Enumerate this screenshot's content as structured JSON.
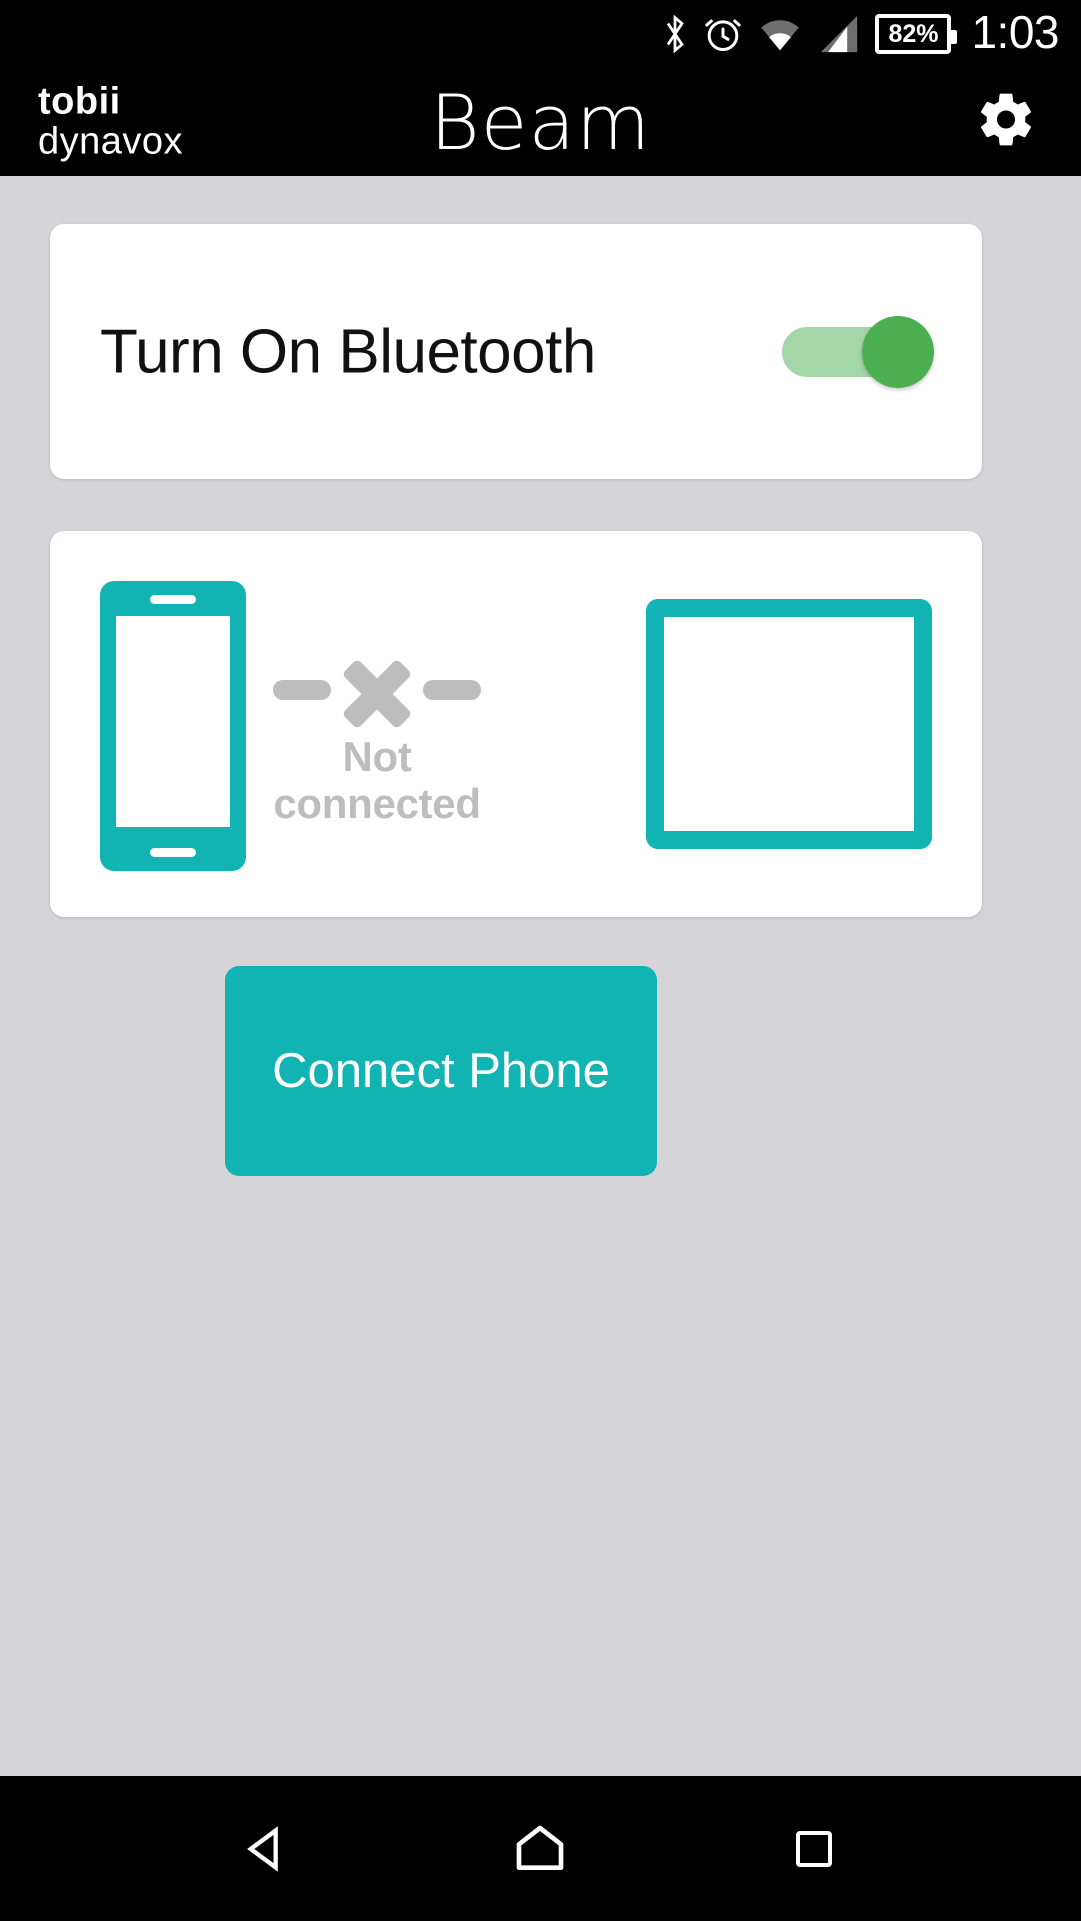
{
  "status_bar": {
    "icons": [
      "bluetooth-icon",
      "alarm-icon",
      "wifi-icon",
      "cellular-signal-icon"
    ],
    "battery_percent": "82%",
    "time": "1:03"
  },
  "app_bar": {
    "brand_line1": "tobii",
    "brand_line2": "dynavox",
    "title": "Beam",
    "settings_icon": "gear-icon"
  },
  "bluetooth_card": {
    "label": "Turn On Bluetooth",
    "toggle": {
      "state": "on",
      "track_color": "#a5d6a7",
      "thumb_color": "#4caf50"
    }
  },
  "device_card": {
    "phone_icon": "phone-icon",
    "tablet_icon": "tablet-icon",
    "connection_icon": "x-disconnected-icon",
    "status_text": "Not connected",
    "status_color": "#bdbdbd",
    "device_color": "#12b3b3"
  },
  "connect_button": {
    "label": "Connect Phone",
    "color": "#12b3b3",
    "text_color": "#ffffff"
  },
  "nav_bar": {
    "back": "back-triangle-icon",
    "home": "home-icon",
    "recents": "recents-square-icon"
  },
  "theme": {
    "accent": "#12b3b3",
    "background": "#d5d5d9",
    "card": "#ffffff",
    "bar": "#000000"
  }
}
